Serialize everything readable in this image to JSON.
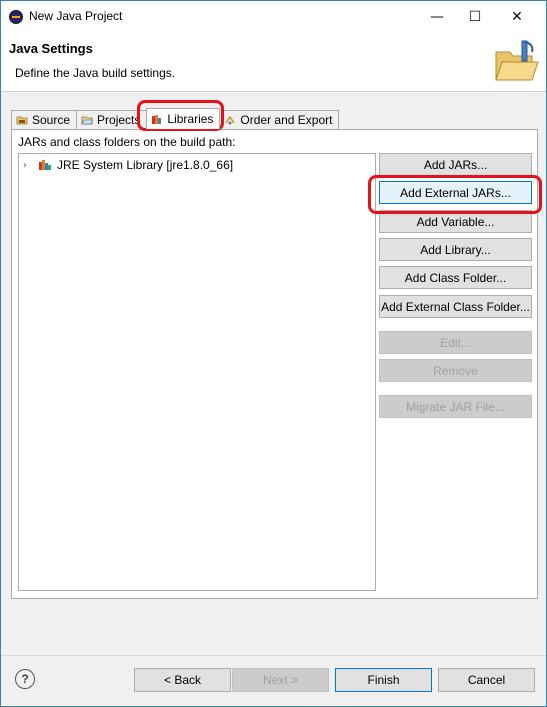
{
  "window": {
    "title": "New Java Project",
    "controls": {
      "minimize": "—",
      "maximize": "☐",
      "close": "✕"
    }
  },
  "header": {
    "title": "Java Settings",
    "description": "Define the Java build settings."
  },
  "tabs": [
    {
      "label": "Source",
      "icon": "source-folder-icon",
      "active": false
    },
    {
      "label": "Projects",
      "icon": "projects-icon",
      "active": false
    },
    {
      "label": "Libraries",
      "icon": "libraries-icon",
      "active": true
    },
    {
      "label": "Order and Export",
      "icon": "order-export-icon",
      "active": false
    }
  ],
  "libraries": {
    "label": "JARs and class folders on the build path:",
    "items": [
      {
        "label": "JRE System Library [jre1.8.0_66]",
        "icon": "jre-library-icon",
        "expandable": true
      }
    ],
    "buttons": {
      "add_jars": "Add JARs...",
      "add_external_jars": "Add External JARs...",
      "add_variable": "Add Variable...",
      "add_library": "Add Library...",
      "add_class_folder": "Add Class Folder...",
      "add_external_class_folder": "Add External Class Folder...",
      "edit": "Edit...",
      "remove": "Remove",
      "migrate_jar": "Migrate JAR File..."
    }
  },
  "footer": {
    "help": "?",
    "back": "< Back",
    "next": "Next >",
    "finish": "Finish",
    "cancel": "Cancel"
  },
  "colors": {
    "highlight": "#e8101a",
    "accent": "#0078d7"
  }
}
